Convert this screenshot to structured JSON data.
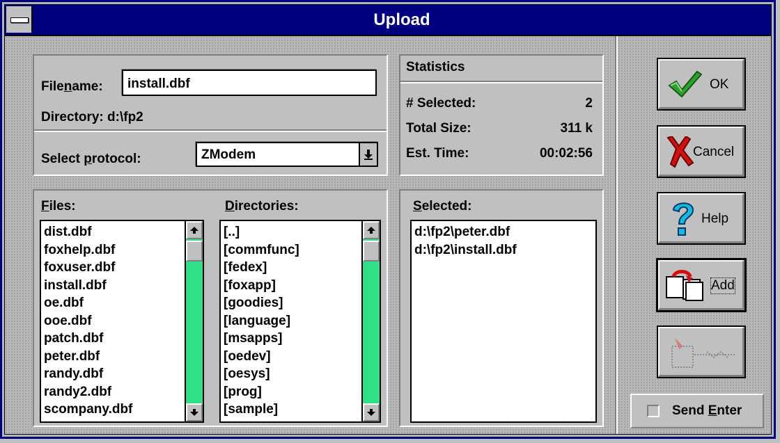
{
  "window": {
    "title": "Upload"
  },
  "file_panel": {
    "filename_label_pre": "File",
    "filename_label_u": "n",
    "filename_label_post": "ame:",
    "filename_value": "install.dbf",
    "directory_label": "Directory:",
    "directory_value": "d:\\fp2",
    "protocol_label_pre": "Select ",
    "protocol_label_u": "p",
    "protocol_label_post": "rotocol:",
    "protocol_value": "ZModem"
  },
  "statistics": {
    "title": "Statistics",
    "rows": [
      {
        "label": "# Selected:",
        "value": "2"
      },
      {
        "label": "Total Size:",
        "value": "311 k"
      },
      {
        "label": "Est. Time:",
        "value": "00:02:56"
      }
    ]
  },
  "files": {
    "label_u": "F",
    "label_post": "iles:",
    "items": [
      "dist.dbf",
      "foxhelp.dbf",
      "foxuser.dbf",
      "install.dbf",
      "oe.dbf",
      "ooe.dbf",
      "patch.dbf",
      "peter.dbf",
      "randy.dbf",
      "randy2.dbf",
      "scompany.dbf"
    ]
  },
  "directories": {
    "label_u": "D",
    "label_post": "irectories:",
    "items": [
      "[..]",
      "[commfunc]",
      "[fedex]",
      "[foxapp]",
      "[goodies]",
      "[language]",
      "[msapps]",
      "[oedev]",
      "[oesys]",
      "[prog]",
      "[sample]"
    ]
  },
  "selected": {
    "label_u": "S",
    "label_post": "elected:",
    "items": [
      "d:\\fp2\\peter.dbf",
      "d:\\fp2\\install.dbf"
    ]
  },
  "buttons": {
    "ok": "OK",
    "cancel": "Cancel",
    "help": "Help",
    "add": "Add",
    "send_enter_pre": "Send ",
    "send_enter_u": "E",
    "send_enter_post": "nter"
  },
  "icons": {
    "ok": "checkmark-icon",
    "cancel": "red-x-icon",
    "help": "question-mark-icon",
    "add": "copy-pages-icon",
    "remove": "remove-disabled-icon"
  },
  "colors": {
    "titlebar": "#000080",
    "scroll_track": "#2fe089",
    "check_green": "#2ea02e",
    "cancel_red": "#d01010",
    "help_cyan": "#18b8e0"
  }
}
